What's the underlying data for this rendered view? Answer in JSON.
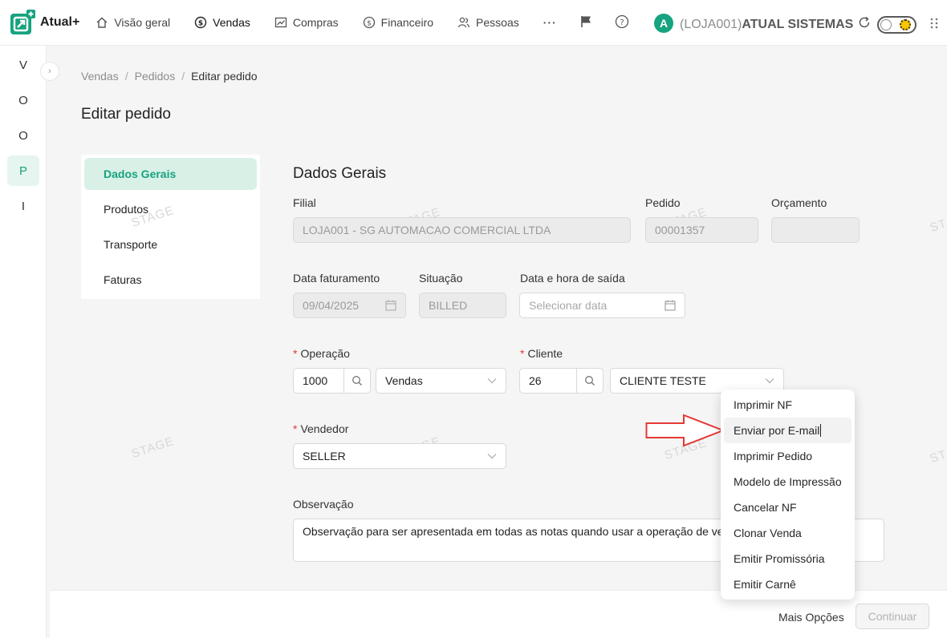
{
  "app": {
    "name": "Atual+"
  },
  "nav": [
    {
      "label": "Visão geral",
      "icon": "home-icon"
    },
    {
      "label": "Vendas",
      "icon": "dollar-icon"
    },
    {
      "label": "Compras",
      "icon": "chart-icon"
    },
    {
      "label": "Financeiro",
      "icon": "dollar-icon"
    },
    {
      "label": "Pessoas",
      "icon": "people-icon"
    }
  ],
  "nav_more": "···",
  "user": {
    "avatar_letter": "A",
    "store": "(LOJA001)",
    "company": "ATUAL SISTEMAS"
  },
  "rail": [
    "V",
    "O",
    "O",
    "P",
    "I"
  ],
  "breadcrumb": {
    "items": [
      "Vendas",
      "Pedidos"
    ],
    "current": "Editar pedido",
    "sep": "/"
  },
  "page_title": "Editar pedido",
  "side_menu": [
    "Dados Gerais",
    "Produtos",
    "Transporte",
    "Faturas"
  ],
  "watermark": "STAGE",
  "form": {
    "section_title": "Dados Gerais",
    "filial": {
      "label": "Filial",
      "value": "LOJA001 - SG AUTOMACAO COMERCIAL LTDA"
    },
    "pedido": {
      "label": "Pedido",
      "value": "00001357"
    },
    "orcamento": {
      "label": "Orçamento",
      "value": ""
    },
    "data_faturamento": {
      "label": "Data faturamento",
      "value": "09/04/2025"
    },
    "situacao": {
      "label": "Situação",
      "value": "BILLED"
    },
    "data_saida": {
      "label": "Data e hora de saída",
      "placeholder": "Selecionar data"
    },
    "operacao": {
      "label": "Operação",
      "code": "1000",
      "name": "Vendas"
    },
    "cliente": {
      "label": "Cliente",
      "code": "26",
      "name": "CLIENTE TESTE"
    },
    "vendedor": {
      "label": "Vendedor",
      "value": "SELLER"
    },
    "observacao": {
      "label": "Observação",
      "value": "Observação para ser apresentada em todas as notas quando usar a operação de venda"
    },
    "required_mark": "*"
  },
  "dropdown": [
    "Imprimir NF",
    "Enviar por E-mail",
    "Imprimir Pedido",
    "Modelo de Impressão",
    "Cancelar NF",
    "Clonar Venda",
    "Emitir Promissória",
    "Emitir Carnê"
  ],
  "footer": {
    "more": "Mais Opções",
    "continue": "Continuar"
  },
  "colors": {
    "brand": "#16a37f",
    "arrow": "#e53935"
  }
}
